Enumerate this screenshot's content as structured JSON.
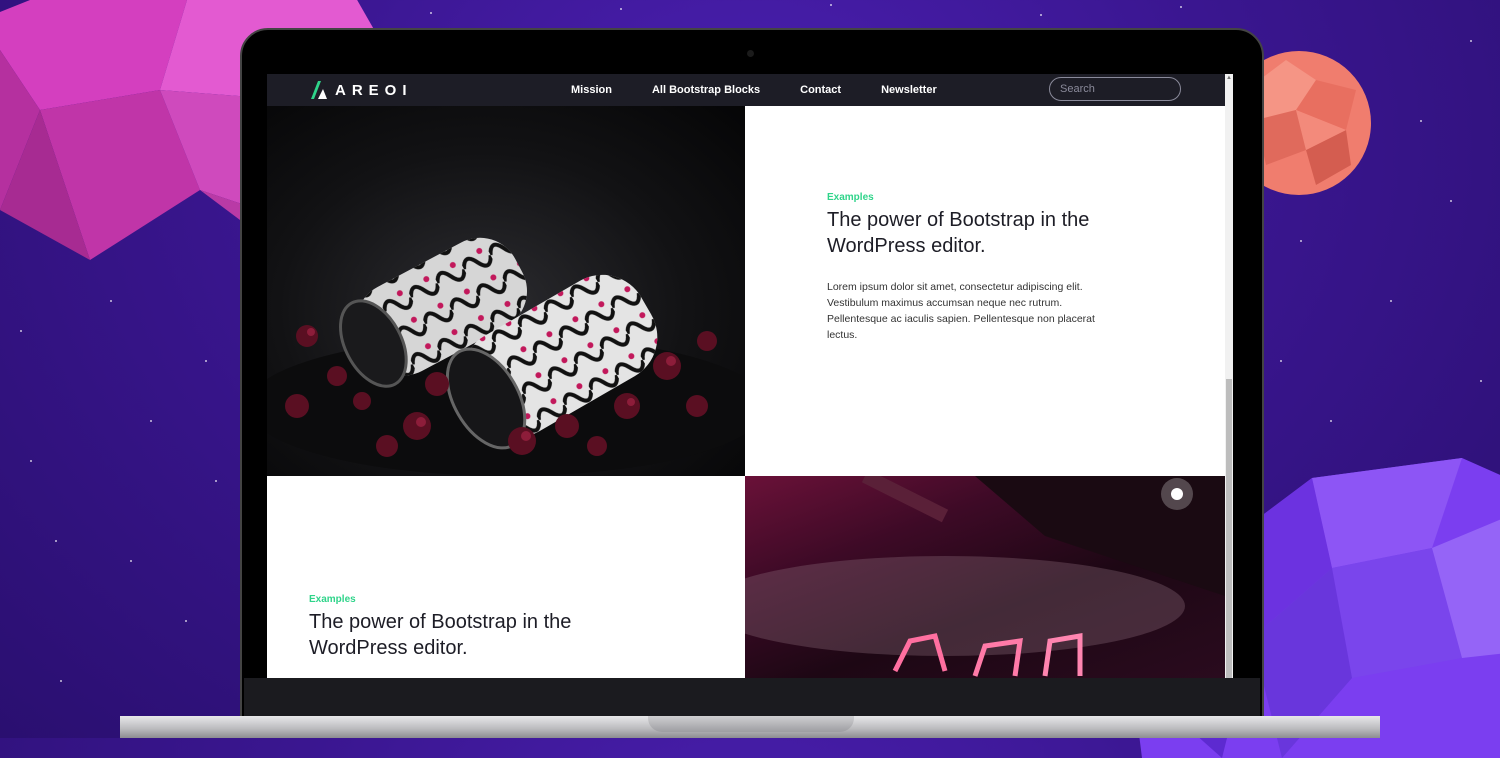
{
  "brand": {
    "logo_text": "AREOI"
  },
  "nav": {
    "links": [
      "Mission",
      "All Bootstrap Blocks",
      "Contact",
      "Newsletter"
    ],
    "search_placeholder": "Search"
  },
  "sections": [
    {
      "eyebrow": "Examples",
      "heading": "The power of Bootstrap in the WordPress editor.",
      "body": "Lorem ipsum dolor sit amet, consectetur adipiscing elit. Vestibulum maximus accumsan neque nec rutrum. Pellentesque ac iaculis sapien. Pellentesque non placerat lectus."
    },
    {
      "eyebrow": "Examples",
      "heading": "The power of Bootstrap in the WordPress editor."
    }
  ],
  "colors": {
    "accent": "#2fd48a",
    "nav_bg": "#1d1d26",
    "backdrop": "#3a1690"
  },
  "icons": [
    "logo-mark-icon",
    "scroll-up-arrow-icon"
  ]
}
